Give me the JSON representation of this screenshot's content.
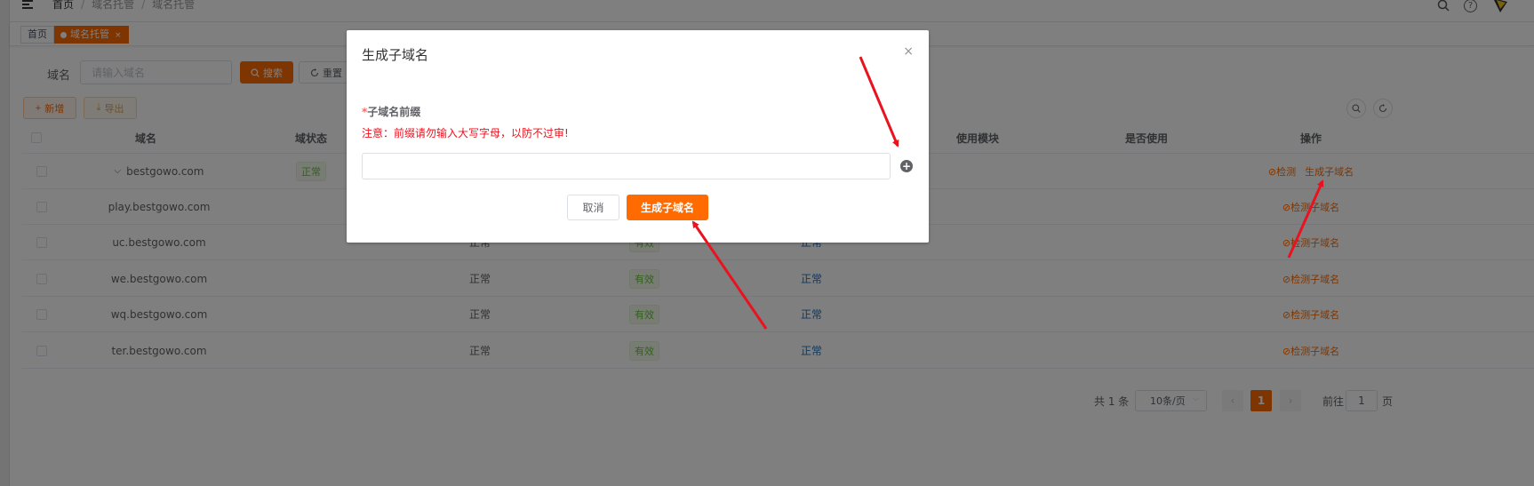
{
  "breadcrumb": [
    "首页",
    "域名托管",
    "域名托管"
  ],
  "tags": {
    "home": "首页",
    "active": "域名托管",
    "active_close": "×"
  },
  "search": {
    "label": "域名",
    "placeholder": "请输入域名",
    "search_btn": "搜索",
    "reset_btn": "重置"
  },
  "toolbar": {
    "add_btn": "新增",
    "export_btn": "导出"
  },
  "table": {
    "headers": [
      "域名",
      "域状态",
      "使用模块",
      "是否使用",
      "操作"
    ],
    "rows": [
      {
        "domain": "bestgowo.com",
        "status": "正常",
        "ops": [
          "检测",
          "生成子域名"
        ]
      },
      {
        "domain": "play.bestgowo.com",
        "status": "",
        "valid": "",
        "state": "",
        "ops": [
          "检测子域名"
        ]
      },
      {
        "domain": "uc.bestgowo.com",
        "status": "正常",
        "valid": "有效",
        "state": "正常",
        "ops": [
          "检测子域名"
        ]
      },
      {
        "domain": "we.bestgowo.com",
        "status": "正常",
        "valid": "有效",
        "state": "正常",
        "ops": [
          "检测子域名"
        ]
      },
      {
        "domain": "wq.bestgowo.com",
        "status": "正常",
        "valid": "有效",
        "state": "正常",
        "ops": [
          "检测子域名"
        ]
      },
      {
        "domain": "ter.bestgowo.com",
        "status": "正常",
        "valid": "有效",
        "state": "正常",
        "ops": [
          "检测子域名"
        ]
      }
    ]
  },
  "pagination": {
    "total": "共 1 条",
    "page_size": "10条/页",
    "current": "1",
    "goto": "前往",
    "goto_value": "1",
    "page_unit": "页"
  },
  "dialog": {
    "title": "生成子域名",
    "close": "×",
    "required_mark": "*",
    "field_label": "子域名前缀",
    "warning": "注意：前缀请勿输入大写字母，以防不过审!",
    "input_value": "",
    "plus": "+",
    "cancel": "取消",
    "submit": "生成子域名"
  },
  "colors": {
    "accent": "#ff6b00",
    "warning": "#e8131f",
    "arrow": "#e8131f",
    "link": "#1a73c9",
    "valid": "#67c23a"
  }
}
